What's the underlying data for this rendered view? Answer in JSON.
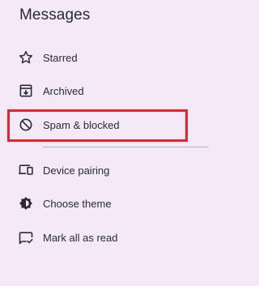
{
  "header": {
    "title": "Messages"
  },
  "menu": {
    "items": [
      {
        "label": "Starred",
        "icon": "star-outline-icon"
      },
      {
        "label": "Archived",
        "icon": "archive-icon"
      },
      {
        "label": "Spam & blocked",
        "icon": "block-icon"
      },
      {
        "label": "Device pairing",
        "icon": "devices-icon"
      },
      {
        "label": "Choose theme",
        "icon": "theme-icon"
      },
      {
        "label": "Mark all as read",
        "icon": "mark-chat-read-icon"
      }
    ]
  },
  "colors": {
    "background": "#f3e9f7",
    "text": "#2b2a33",
    "highlight_border": "#e3262d",
    "divider": "#b9b4bf"
  }
}
